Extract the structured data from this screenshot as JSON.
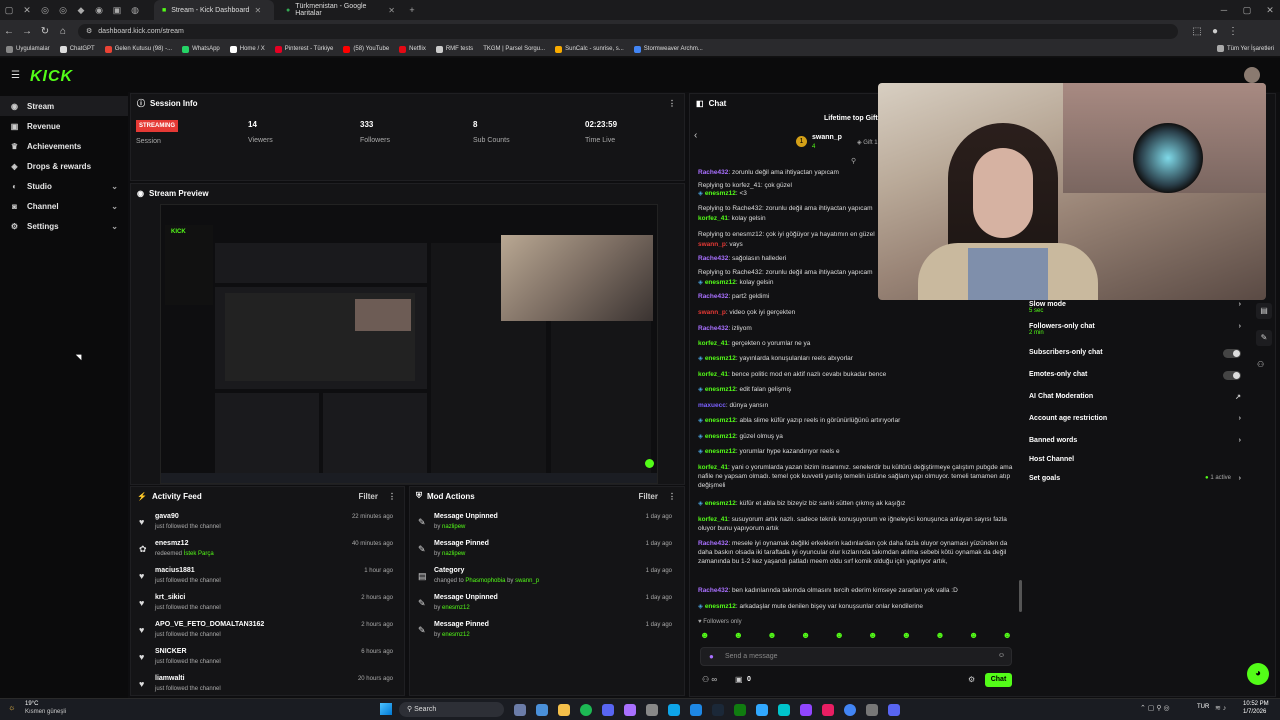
{
  "browser": {
    "tabs": [
      {
        "label": "Stream - Kick Dashboard",
        "active": true
      },
      {
        "label": "Türkmenistan - Google Haritalar",
        "active": false
      }
    ],
    "url": "dashboard.kick.com/stream",
    "bookmarks": [
      "Uygulamalar",
      "ChatGPT",
      "Gelen Kutusu (98) -...",
      "WhatsApp",
      "Home / X",
      "Pinterest - Türkiye",
      "(58) YouTube",
      "Netflix",
      "RMF tests",
      "TKGM | Parsel Sorgu...",
      "SunCalc - sunrise, s...",
      "Stormweaver Archm..."
    ],
    "bookmarks_right": "Tüm Yer İşaretleri"
  },
  "app": {
    "logo": "KICK"
  },
  "sidebar": {
    "items": [
      {
        "label": "Stream",
        "icon": "broadcast-icon"
      },
      {
        "label": "Revenue",
        "icon": "wallet-icon"
      },
      {
        "label": "Achievements",
        "icon": "trophy-icon"
      },
      {
        "label": "Drops & rewards",
        "icon": "gift-icon"
      },
      {
        "label": "Studio",
        "icon": "studio-icon"
      },
      {
        "label": "Channel",
        "icon": "channel-icon"
      },
      {
        "label": "Settings",
        "icon": "gear-icon"
      }
    ]
  },
  "session": {
    "title": "Session Info",
    "status": "STREAMING",
    "status_label": "Session",
    "viewers": "14",
    "viewers_label": "Viewers",
    "followers": "333",
    "followers_label": "Followers",
    "subs": "8",
    "subs_label": "Sub Counts",
    "time": "02:23:59",
    "time_label": "Time Live"
  },
  "preview": {
    "title": "Stream Preview"
  },
  "activity": {
    "title": "Activity Feed",
    "filter": "Filter",
    "items": [
      {
        "name": "gava90",
        "sub": "just followed the channel",
        "time": "22 minutes ago",
        "icon": "heart-icon"
      },
      {
        "name": "enesmz12",
        "sub": "redeemed",
        "extra": "İstek Parça",
        "time": "40 minutes ago",
        "icon": "redeem-icon"
      },
      {
        "name": "macius1881",
        "sub": "just followed the channel",
        "time": "1 hour ago",
        "icon": "heart-icon"
      },
      {
        "name": "krt_sikici",
        "sub": "just followed the channel",
        "time": "2 hours ago",
        "icon": "heart-icon"
      },
      {
        "name": "APO_VE_FETO_DOMALTAN3162",
        "sub": "just followed the channel",
        "time": "2 hours ago",
        "icon": "heart-icon"
      },
      {
        "name": "SNICKER",
        "sub": "just followed the channel",
        "time": "6 hours ago",
        "icon": "heart-icon"
      },
      {
        "name": "liamwalti",
        "sub": "just followed the channel",
        "time": "20 hours ago",
        "icon": "heart-icon"
      }
    ]
  },
  "modactions": {
    "title": "Mod Actions",
    "filter": "Filter",
    "items": [
      {
        "name": "Message Unpinned",
        "by": "by",
        "user": "nazlipew",
        "time": "1 day ago",
        "icon": "pin-icon"
      },
      {
        "name": "Message Pinned",
        "by": "by",
        "user": "nazlipew",
        "time": "1 day ago",
        "icon": "pin-icon"
      },
      {
        "name": "Category",
        "by": "changed to",
        "user": "Phasmophobia",
        "by2": "by",
        "user2": "swann_p",
        "time": "1 day ago",
        "icon": "category-icon"
      },
      {
        "name": "Message Unpinned",
        "by": "by",
        "user": "enesmz12",
        "time": "1 day ago",
        "icon": "pin-icon"
      },
      {
        "name": "Message Pinned",
        "by": "by",
        "user": "enesmz12",
        "time": "1 day ago",
        "icon": "pin-icon"
      }
    ]
  },
  "chat": {
    "title": "Chat",
    "top_gifter_title": "Lifetime top Gift",
    "top_gifter": "swann_p",
    "top_gifter_sub": "Gift 1 su",
    "top_gifter_count": "4",
    "messages": [
      {
        "user": "Rache432",
        "text": ": zorunlu değil ama ihtiyactan yapıcam",
        "cls": "u1"
      },
      {
        "reply": "Replying to korfez_41: çok güzel",
        "user": "enesmz12",
        "text": ": <3",
        "cls": "u2"
      },
      {
        "user": "korfez_41",
        "text": ": kolay gelsin",
        "cls": "u2",
        "reply": "Replying to Rache432: zorunlu değil ama ihtiyactan yapıcam"
      },
      {
        "reply": "Replying to enesmz12: çok iyi göğüyor ya hayatımın en güzel",
        "user": "swann_p",
        "text": ": vays",
        "cls": "u3"
      },
      {
        "user": "Rache432",
        "text": ": sağolasın hallederi",
        "cls": "u1"
      },
      {
        "reply": "Replying to Rache432: zorunlu değil ama ihtiyactan yapıcam",
        "user": "enesmz12",
        "text": ": kolay gelsin",
        "cls": "u2"
      },
      {
        "user": "Rache432",
        "text": ": part2 geldimi",
        "cls": "u1"
      },
      {
        "user": "swann_p",
        "text": ": video çok iyi gerçekten",
        "cls": "u3"
      },
      {
        "user": "Rache432",
        "text": ": izliyom",
        "cls": "u1"
      },
      {
        "user": "korfez_41",
        "text": ": gerçekten o yorumlar ne ya",
        "cls": "u2"
      },
      {
        "user": "enesmz12",
        "text": ": yayınlarda konuşulanları reels abıyorlar",
        "cls": "u2"
      },
      {
        "user": "korfez_41",
        "text": ": bence politic mod en aktif nazlı cevabı bukadar bence",
        "cls": "u2"
      },
      {
        "user": "enesmz12",
        "text": ": edit falan gelişmiş",
        "cls": "u2"
      },
      {
        "user": "maxuecc",
        "text": ": dünya yansın",
        "cls": "u4"
      },
      {
        "user": "enesmz12",
        "text": ": abla slime küfür yazıp reels in görünürlüğünü artırıyorlar",
        "cls": "u2"
      },
      {
        "user": "enesmz12",
        "text": ": güzel olmuş ya",
        "cls": "u2"
      },
      {
        "user": "enesmz12",
        "text": ": yorumlar hype kazandırıyor reels e",
        "cls": "u2"
      },
      {
        "user": "korfez_41",
        "text": ": yani o yorumlarda yazan bizim insanımız. senelerdir bu kültürü değiştirmeye çalıştım pubgde ama nafile ne yapsam olmadı. temel çok kuvvetli yanlış temelin üstüne sağlam yapı olmuyor. temeli tamamen atıp değişmeli",
        "cls": "u2"
      },
      {
        "user": "enesmz12",
        "text": ": küfür et abla biz bizeyiz biz sanki sütten çıkmış ak kaşığız",
        "cls": "u2"
      },
      {
        "user": "korfez_41",
        "text": ": susuyorum artık nazlı. sadece teknik konuşuyorum ve iğneleyici konuşunca anlayan sayısı fazla oluyor bunu yapıyorum artık",
        "cls": "u2"
      },
      {
        "user": "Rache432",
        "text": ": mesele iyi oynamak değilki erkeklerin kadınlardan çok daha fazla oluyor oynaması yüzünden da daha baskın olsada iki taraftada iyi oyuncular olur kızlarında takımdan atılma sebebi kötü oynamak da değil zamanında bu 1-2 kez yaşandı patladı meem oldu sırf komik olduğu için yapılıyor artık,",
        "cls": "u1"
      },
      {
        "user": "Rache432",
        "text": ": ben kadınlarında takımda olmasını tercih ederim kimseye zararları yok valla :D",
        "cls": "u1"
      },
      {
        "user": "enesmz12",
        "text": ": arkadaşlar mute denilen bişey var konuşsunlar onlar kendilerine",
        "cls": "u2"
      }
    ],
    "followers_only": "Followers only",
    "placeholder": "Send a message",
    "send": "Chat",
    "count": "0"
  },
  "settings": {
    "items": [
      {
        "label": "Slow mode",
        "sub": "5 sec",
        "kind": "chev"
      },
      {
        "label": "Followers-only chat",
        "sub": "2 min",
        "kind": "chev"
      },
      {
        "label": "Subscribers-only chat",
        "sub": "",
        "kind": "toggle"
      },
      {
        "label": "Emotes-only chat",
        "sub": "",
        "kind": "toggle"
      },
      {
        "label": "AI Chat Moderation",
        "sub": "",
        "kind": "ext"
      },
      {
        "label": "Account age restriction",
        "sub": "",
        "kind": "chev"
      },
      {
        "label": "Banned words",
        "sub": "",
        "kind": "chev"
      },
      {
        "label": "Host Channel",
        "sub": "",
        "kind": "none"
      },
      {
        "label": "Set goals",
        "sub": "",
        "kind": "chev",
        "right": "1 active"
      }
    ]
  },
  "taskbar": {
    "weather_temp": "19°C",
    "weather_text": "Kısmen güneşli",
    "search": "Search",
    "lang": "TUR",
    "time": "10:52 PM",
    "date": "1/7/2026"
  }
}
